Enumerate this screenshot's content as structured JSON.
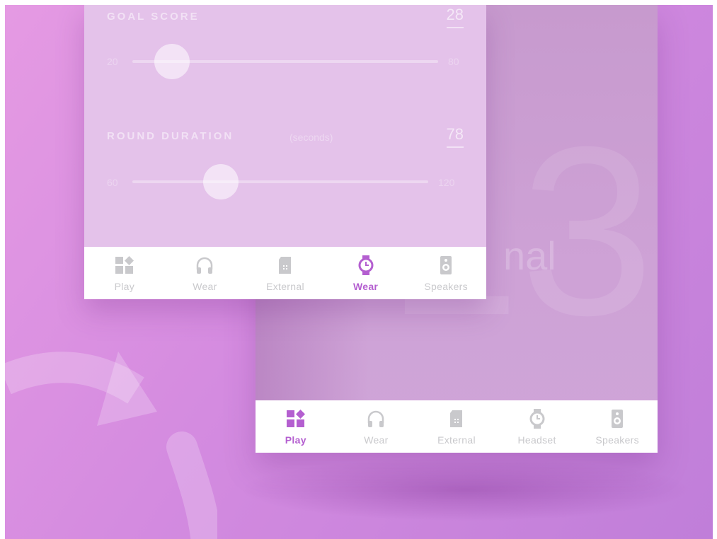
{
  "colors": {
    "accent": "#b45fd0",
    "inactive": "#c9c9cc",
    "background": "#d48be0"
  },
  "back_screen": {
    "big_number": "13",
    "ghost_label": "nal",
    "tabs": [
      {
        "label": "Play",
        "icon": "play-grid-icon",
        "active": true
      },
      {
        "label": "Wear",
        "icon": "headphones-icon",
        "active": false
      },
      {
        "label": "External",
        "icon": "sd-card-icon",
        "active": false
      },
      {
        "label": "Headset",
        "icon": "watch-icon",
        "active": false
      },
      {
        "label": "Speakers",
        "icon": "speaker-icon",
        "active": false
      }
    ]
  },
  "front_screen": {
    "goal_score": {
      "title": "GOAL SCORE",
      "value": "28",
      "min": "20",
      "max": "80",
      "fraction": 0.13
    },
    "round_duration": {
      "title": "ROUND DURATION",
      "unit": "(seconds)",
      "value": "78",
      "min": "60",
      "max": "120",
      "fraction": 0.3
    },
    "tabs": [
      {
        "label": "Play",
        "icon": "play-grid-icon",
        "active": false
      },
      {
        "label": "Wear",
        "icon": "headphones-icon",
        "active": false
      },
      {
        "label": "External",
        "icon": "sd-card-icon",
        "active": false
      },
      {
        "label": "Wear",
        "icon": "watch-icon",
        "active": true
      },
      {
        "label": "Speakers",
        "icon": "speaker-icon",
        "active": false
      }
    ]
  }
}
